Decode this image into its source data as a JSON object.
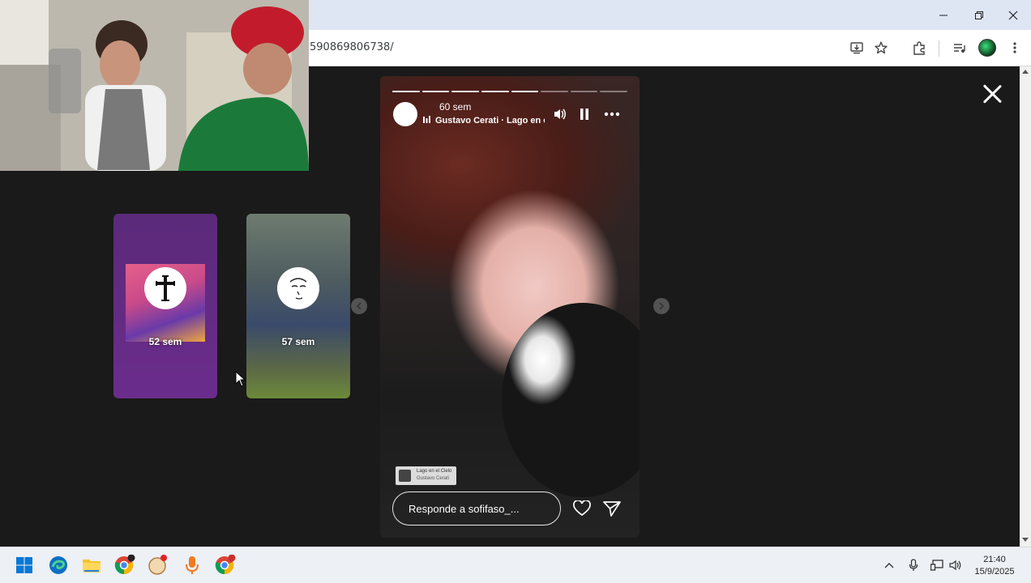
{
  "browser": {
    "url_fragment": "590869806738/",
    "window_controls": [
      "minimize",
      "restore",
      "close"
    ],
    "toolbar_icons": [
      "install-app-icon",
      "bookmark-star-icon",
      "extensions-icon",
      "media-control-icon",
      "profile-avatar",
      "menu-kebab-icon"
    ]
  },
  "stories": {
    "thumbnails": [
      {
        "time": "52 sem",
        "avatar_icon": "cross-icon"
      },
      {
        "time": "57 sem",
        "avatar_icon": "face-sketch-icon"
      }
    ],
    "active": {
      "progress_total": 8,
      "progress_done": 5,
      "time": "60 sem",
      "music_line": "Gustavo Cerati · Lago en el",
      "sticker_title": "Lago en el Cielo",
      "sticker_artist": "Gustavo Cerati",
      "reply_placeholder": "Responde a sofifaso_..."
    }
  },
  "taskbar": {
    "time": "21:40",
    "date": "15/9/2025",
    "apps": [
      "start-icon",
      "edge-icon",
      "file-explorer-icon",
      "chrome-icon",
      "app-icon",
      "microphone-app-icon",
      "chrome-profile-icon"
    ]
  },
  "colors": {
    "viewport_bg": "#1a1a1a",
    "titlebar_bg": "#dfe6f3",
    "story_thumb_purple": "#6b2c8c"
  }
}
